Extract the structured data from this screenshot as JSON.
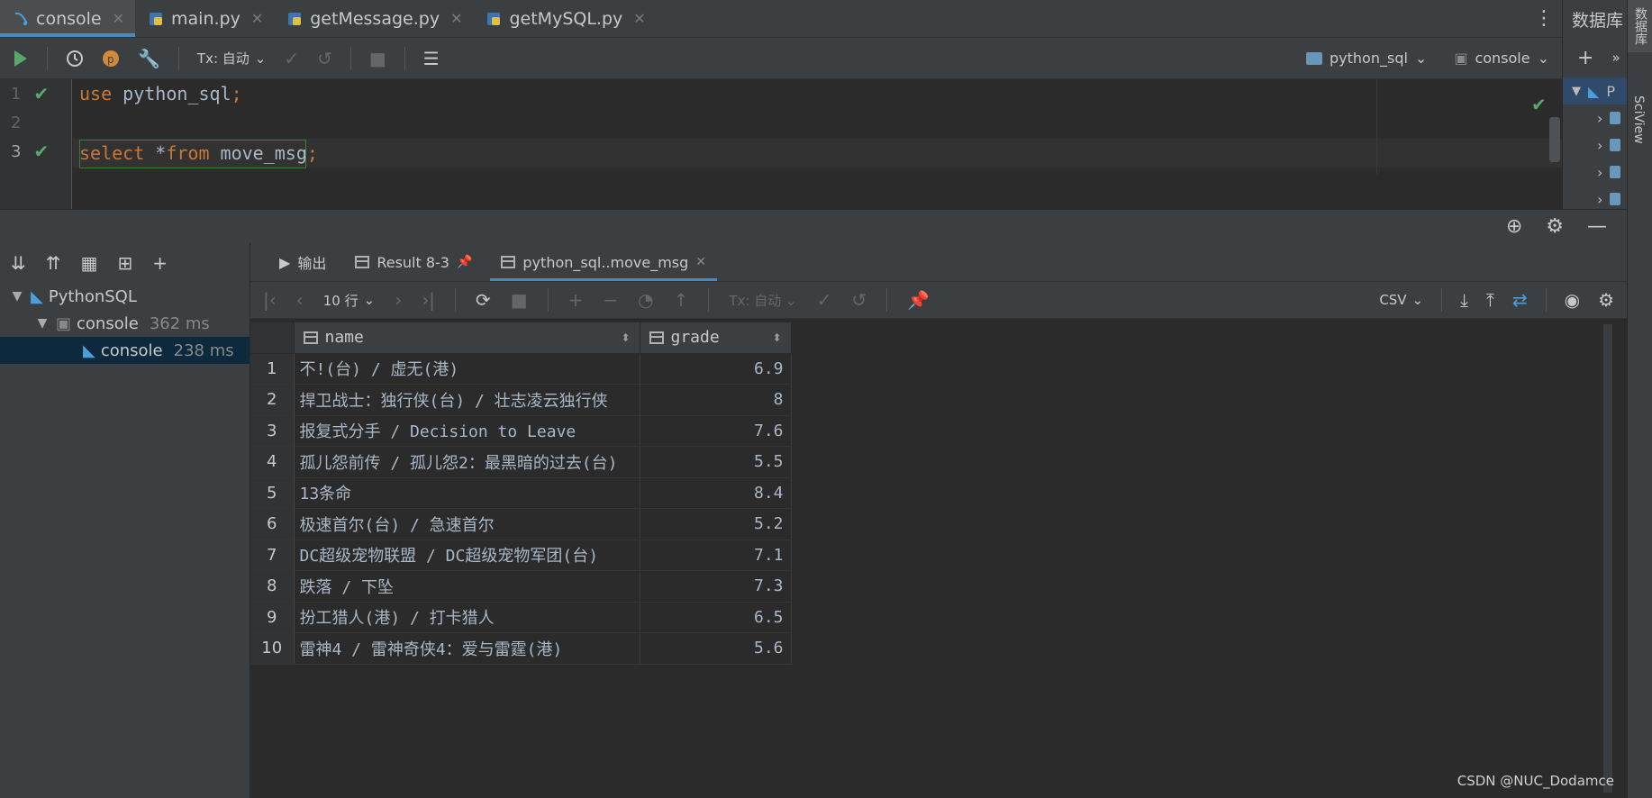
{
  "editor_tabs": [
    {
      "label": "console",
      "active": true
    },
    {
      "label": "main.py",
      "active": false
    },
    {
      "label": "getMessage.py",
      "active": false
    },
    {
      "label": "getMySQL.py",
      "active": false
    }
  ],
  "db_panel": {
    "title": "数据库",
    "selected_item": "P"
  },
  "side_strip": {
    "database": "数据库",
    "sciview": "SciView"
  },
  "editor_toolbar": {
    "tx_mode": "Tx: 自动",
    "schema": "python_sql",
    "session": "console"
  },
  "editor": {
    "lines": [
      {
        "number": "1",
        "ok": true,
        "keyword": "use",
        "text": " python_sql",
        "punct": ";"
      },
      {
        "number": "2",
        "ok": false,
        "keyword": "",
        "text": "",
        "punct": ""
      },
      {
        "number": "3",
        "ok": true,
        "keyword": "select",
        "star": " *",
        "keyword2": "from",
        "text": " move_msg",
        "punct": ";"
      }
    ]
  },
  "services_tree": {
    "root": "PythonSQL",
    "child": {
      "label": "console",
      "time": "362 ms"
    },
    "leaf": {
      "label": "console",
      "time": "238 ms"
    }
  },
  "result_tabs": [
    {
      "label": "输出",
      "active": false
    },
    {
      "label": "Result 8-3",
      "active": false
    },
    {
      "label": "python_sql..move_msg",
      "active": true
    }
  ],
  "result_toolbar": {
    "rows": "10 行",
    "tx_mode": "Tx: 自动",
    "export": "CSV"
  },
  "grid": {
    "columns": [
      "name",
      "grade"
    ],
    "rows": [
      {
        "n": "1",
        "name": "不!(台) / 虚无(港)",
        "grade": "6.9"
      },
      {
        "n": "2",
        "name": "捍卫战士：独行侠(台) / 壮志凌云独行侠",
        "grade": "8"
      },
      {
        "n": "3",
        "name": "报复式分手 / Decision to Leave",
        "grade": "7.6"
      },
      {
        "n": "4",
        "name": "孤儿怨前传 / 孤儿怨2：最黑暗的过去(台)",
        "grade": "5.5"
      },
      {
        "n": "5",
        "name": "13条命",
        "grade": "8.4"
      },
      {
        "n": "6",
        "name": "极速首尔(台) / 急速首尔",
        "grade": "5.2"
      },
      {
        "n": "7",
        "name": "DC超级宠物联盟 / DC超级宠物军团(台)",
        "grade": "7.1"
      },
      {
        "n": "8",
        "name": "跌落 / 下坠",
        "grade": "7.3"
      },
      {
        "n": "9",
        "name": "扮工猎人(港) / 打卡猎人",
        "grade": "6.5"
      },
      {
        "n": "10",
        "name": "雷神4 / 雷神奇侠4：爱与雷霆(港)",
        "grade": "5.6"
      }
    ]
  },
  "watermark": "CSDN @NUC_Dodamce",
  "colors": {
    "accent": "#4a88c7",
    "keyword": "#cc7832",
    "ok": "#59a869",
    "background": "#2b2b2b"
  }
}
